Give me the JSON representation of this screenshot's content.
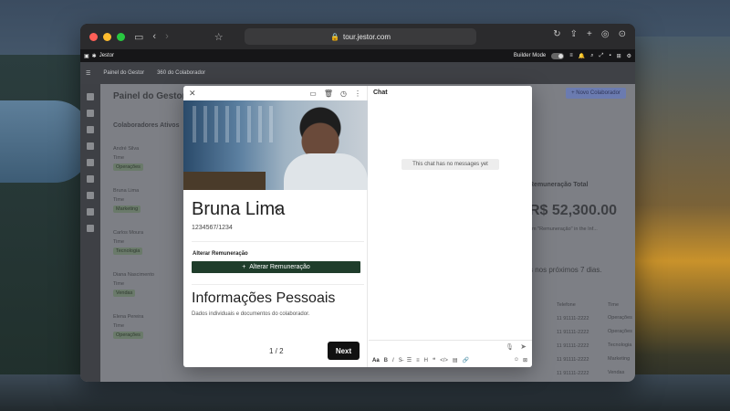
{
  "browser": {
    "url": "tour.jestor.com",
    "app_name": "Jestor",
    "builder_mode_label": "Builder Mode"
  },
  "app": {
    "breadcrumbs": [
      "Painel do Gestor",
      "360 do Colaborador"
    ],
    "page_title": "Painel do Gestor",
    "new_button": "+ Novo Colaborador",
    "section_title": "Colaboradores Ativos",
    "collaborators": [
      {
        "name": "André Silva",
        "field": "Time",
        "tag": "Operações"
      },
      {
        "name": "Bruna Lima",
        "field": "Time",
        "tag": "Marketing"
      },
      {
        "name": "Carlos Moura",
        "field": "Time",
        "tag": "Tecnologia"
      },
      {
        "name": "Diana Nascimento",
        "field": "Time",
        "tag": "Vendas"
      },
      {
        "name": "Elena Pereira",
        "field": "Time",
        "tag": "Operações"
      }
    ],
    "kpi_label": "Remuneração Total",
    "kpi_value": "R$ 52,300.00",
    "kpi_sub": "em \"Remuneração\" in the Inf...",
    "notice": "s nos próximos 7 dias.",
    "phone_header": "Telefone",
    "team_header": "Time",
    "phones": [
      "11 91111-2222",
      "11 91111-2222",
      "11 91111-2222",
      "11 91111-2222",
      "11 91111-2222"
    ],
    "team_tags": [
      "Operações",
      "Operações",
      "Tecnologia",
      "Marketing",
      "Vendas"
    ]
  },
  "modal": {
    "name": "Bruna Lima",
    "code": "1234567/1234",
    "alter_label": "Alterar Remuneração",
    "alter_button": "Alterar Remuneração",
    "section_title": "Informações Pessoais",
    "section_sub": "Dados individuais e documentos do colaborador.",
    "pager": "1 / 2",
    "next_label": "Next"
  },
  "chat": {
    "title": "Chat",
    "empty_text": "This chat has no messages yet",
    "format_aa": "Aa"
  }
}
